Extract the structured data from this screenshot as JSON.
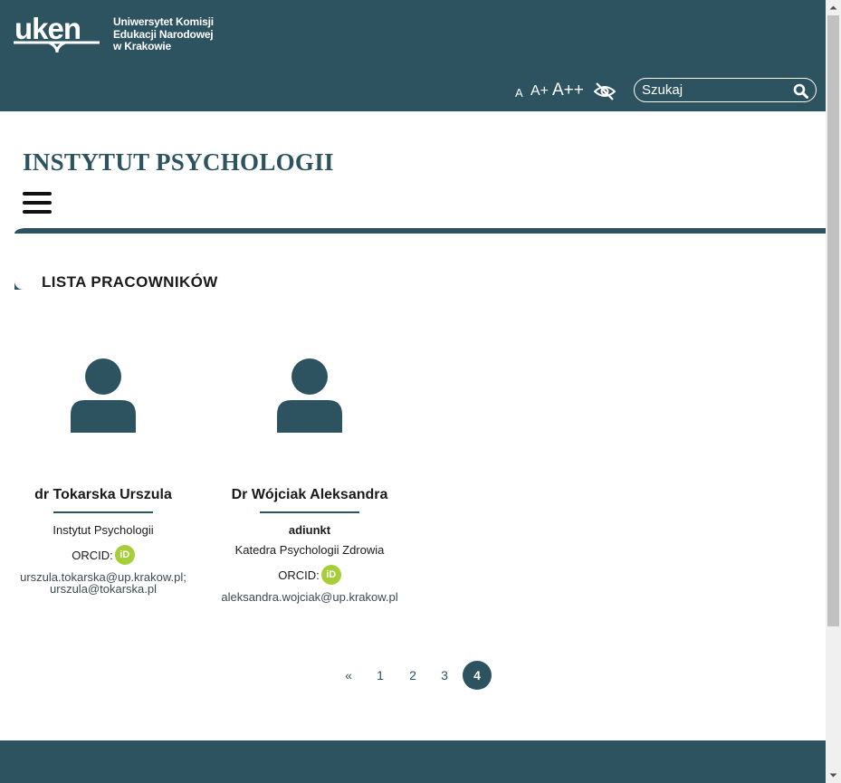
{
  "header": {
    "logo": {
      "mark_text": "uken",
      "text_lines": [
        "Uniwersytet Komisji",
        "Edukacji Narodowej",
        "w Krakowie"
      ]
    },
    "font_size": {
      "small": "A",
      "medium": "A+",
      "large": "A++"
    },
    "contrast_icon": "eye-slash-icon",
    "search": {
      "placeholder": "Szukaj"
    }
  },
  "institute": {
    "title": "INSTYTUT PSYCHOLOGII"
  },
  "section": {
    "title": "LISTA PRACOWNIKÓW"
  },
  "staff": [
    {
      "name": "dr Tokarska Urszula",
      "position": "",
      "unit": "Instytut Psychologii",
      "orcid_label": "ORCID:",
      "emails": [
        "urszula.tokarska@up.krakow.pl;",
        "urszula@tokarska.pl"
      ]
    },
    {
      "name": "Dr Wójciak Aleksandra",
      "position": "adiunkt",
      "unit": "Katedra Psychologii Zdrowia",
      "orcid_label": "ORCID:",
      "emails": [
        "aleksandra.wojciak@up.krakow.pl"
      ]
    }
  ],
  "orcid_badge": "iD",
  "pagination": {
    "prev": "«",
    "pages": [
      "1",
      "2",
      "3",
      "4"
    ],
    "current": "4"
  },
  "colors": {
    "brand": "#2c535f",
    "orcid": "#a6ce39"
  }
}
